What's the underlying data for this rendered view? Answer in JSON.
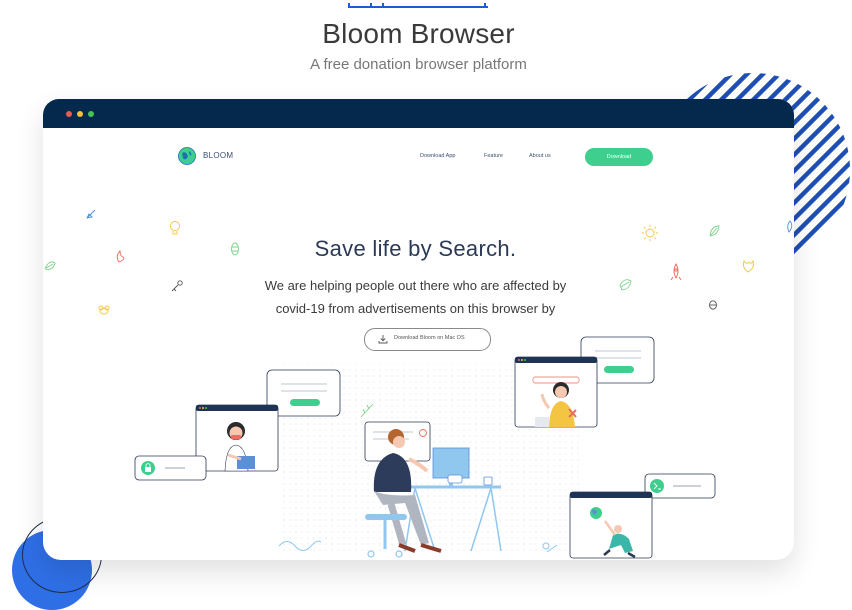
{
  "page": {
    "title": "Bloom Browser",
    "subtitle": "A free donation browser platform"
  },
  "nav": {
    "brand": "BLOOM",
    "links": [
      "Download App",
      "Feature",
      "About us"
    ],
    "download_label": "Download"
  },
  "hero": {
    "title": "Save life by Search.",
    "line1": "We are helping people out there who are affected by",
    "line2": "covid-19 from advertisements on this browser by",
    "mac_button": "Download Bloom on Mac OS"
  },
  "colors": {
    "titlebar": "#05284d",
    "accent_green": "#3ecf8e",
    "accent_blue": "#2f6fe6",
    "traffic_red": "#ec5b4f",
    "traffic_yellow": "#f4be3c",
    "traffic_green": "#45c456"
  },
  "icons": [
    "leaf-icon",
    "lightbulb-icon",
    "fire-icon",
    "key-icon",
    "bee-icon",
    "sun-icon",
    "rocket-icon",
    "drop-icon",
    "globe-icon",
    "lock-icon",
    "terminal-icon",
    "download-icon"
  ]
}
